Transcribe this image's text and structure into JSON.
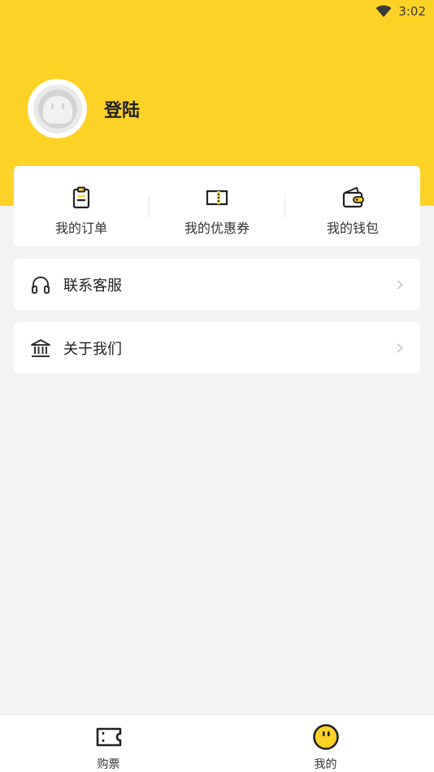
{
  "status_bar": {
    "time": "3:02",
    "wifi_icon": "wifi-icon"
  },
  "profile": {
    "login_label": "登陆",
    "avatar_icon": "avatar-face-icon"
  },
  "quick_actions": [
    {
      "label": "我的订单",
      "icon": "clipboard-icon"
    },
    {
      "label": "我的优惠券",
      "icon": "coupon-icon"
    },
    {
      "label": "我的钱包",
      "icon": "wallet-icon"
    }
  ],
  "menu": [
    {
      "label": "联系客服",
      "icon": "headphones-icon"
    },
    {
      "label": "关于我们",
      "icon": "building-icon"
    }
  ],
  "bottom_nav": [
    {
      "label": "购票",
      "icon": "ticket-icon",
      "active": false
    },
    {
      "label": "我的",
      "icon": "smiley-icon",
      "active": true
    }
  ],
  "colors": {
    "accent": "#fdd226",
    "background": "#f3f3f3",
    "card": "#ffffff"
  }
}
